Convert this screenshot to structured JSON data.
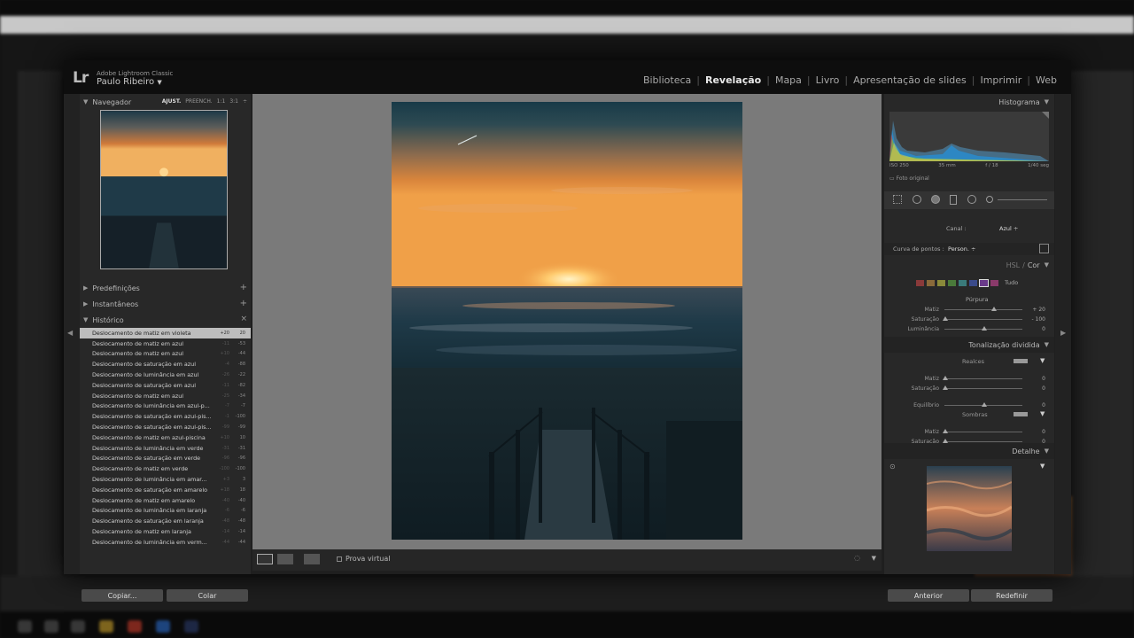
{
  "background": {
    "colors": {
      "accent": "#d98a3f"
    }
  },
  "header": {
    "logo": "Lr",
    "product": "Adobe Lightroom Classic",
    "user": "Paulo Ribeiro",
    "modules": [
      "Biblioteca",
      "Revelação",
      "Mapa",
      "Livro",
      "Apresentação de slides",
      "Imprimir",
      "Web"
    ],
    "active_module": "Revelação"
  },
  "left": {
    "navigator": {
      "title": "Navegador",
      "options": [
        "AJUST.",
        "PREENCH.",
        "1:1",
        "3:1"
      ]
    },
    "presets": {
      "title": "Predefinições"
    },
    "snapshots": {
      "title": "Instantâneos"
    },
    "history": {
      "title": "Histórico",
      "items": [
        {
          "label": "Deslocamento de matiz em violeta",
          "v1": "+20",
          "v2": "20"
        },
        {
          "label": "Deslocamento de matiz em azul",
          "v1": "-11",
          "v2": "-53"
        },
        {
          "label": "Deslocamento de matiz em azul",
          "v1": "+10",
          "v2": "-44"
        },
        {
          "label": "Deslocamento de saturação em azul",
          "v1": "-4",
          "v2": "-88"
        },
        {
          "label": "Deslocamento de luminância em azul",
          "v1": "-26",
          "v2": "-22"
        },
        {
          "label": "Deslocamento de saturação em azul",
          "v1": "-11",
          "v2": "-82"
        },
        {
          "label": "Deslocamento de matiz em azul",
          "v1": "-25",
          "v2": "-34"
        },
        {
          "label": "Deslocamento de luminância em azul-p...",
          "v1": "-7",
          "v2": "-7"
        },
        {
          "label": "Deslocamento de saturação em azul-pis...",
          "v1": "-1",
          "v2": "-100"
        },
        {
          "label": "Deslocamento de saturação em azul-pis...",
          "v1": "-99",
          "v2": "-99"
        },
        {
          "label": "Deslocamento de matiz em azul-piscina",
          "v1": "+10",
          "v2": "10"
        },
        {
          "label": "Deslocamento de luminância em verde",
          "v1": "-31",
          "v2": "-31"
        },
        {
          "label": "Deslocamento de saturação em verde",
          "v1": "-96",
          "v2": "-96"
        },
        {
          "label": "Deslocamento de matiz em verde",
          "v1": "-100",
          "v2": "-100"
        },
        {
          "label": "Deslocamento de luminância em amar...",
          "v1": "+3",
          "v2": "3"
        },
        {
          "label": "Deslocamento de saturação em amarelo",
          "v1": "+18",
          "v2": "18"
        },
        {
          "label": "Deslocamento de matiz em amarelo",
          "v1": "-40",
          "v2": "-40"
        },
        {
          "label": "Deslocamento de luminância em laranja",
          "v1": "-6",
          "v2": "-6"
        },
        {
          "label": "Deslocamento de saturação em laranja",
          "v1": "-48",
          "v2": "-48"
        },
        {
          "label": "Deslocamento de matiz em laranja",
          "v1": "-14",
          "v2": "-14"
        },
        {
          "label": "Deslocamento de luminância em verm...",
          "v1": "-44",
          "v2": "-44"
        }
      ]
    },
    "buttons": {
      "copy": "Copiar...",
      "paste": "Colar"
    }
  },
  "toolbar": {
    "soft_proof": "Prova virtual"
  },
  "right": {
    "histogram": {
      "title": "Histograma",
      "iso": "ISO 250",
      "focal": "35 mm",
      "aperture": "f / 18",
      "shutter": "1/40 seg",
      "original": "Foto original"
    },
    "curve": {
      "channel_label": "Canal :",
      "channel_value": "Azul ÷",
      "points_label": "Curva de pontos :",
      "points_value": "Person. ÷"
    },
    "hsl": {
      "title": "HSL",
      "sep": "/",
      "title2": "Cor",
      "all": "Tudo",
      "swatches": [
        "#8a3a3a",
        "#8a6a3a",
        "#8a8a3a",
        "#4a7a3a",
        "#3a7a7a",
        "#3a4a8a",
        "#6a3a8a",
        "#8a3a6a"
      ],
      "color_name": "Púrpura",
      "sliders": [
        {
          "label": "Matiz",
          "value": "+ 20",
          "pos": 0.62
        },
        {
          "label": "Saturação",
          "value": "- 100",
          "pos": 0.0
        },
        {
          "label": "Luminância",
          "value": "0",
          "pos": 0.5
        }
      ]
    },
    "split": {
      "title": "Tonalização dividida",
      "highlights": "Realces",
      "shadows": "Sombras",
      "balance": "Equilíbrio",
      "rows": [
        {
          "label": "Matiz",
          "value": "0",
          "pos": 0.0
        },
        {
          "label": "Saturação",
          "value": "0",
          "pos": 0.0
        },
        {
          "label": "Equilíbrio",
          "value": "0",
          "pos": 0.5
        },
        {
          "label": "Matiz",
          "value": "0",
          "pos": 0.0
        },
        {
          "label": "Saturação",
          "value": "0",
          "pos": 0.0
        }
      ]
    },
    "detail": {
      "title": "Detalhe"
    },
    "buttons": {
      "previous": "Anterior",
      "reset": "Redefinir"
    }
  }
}
